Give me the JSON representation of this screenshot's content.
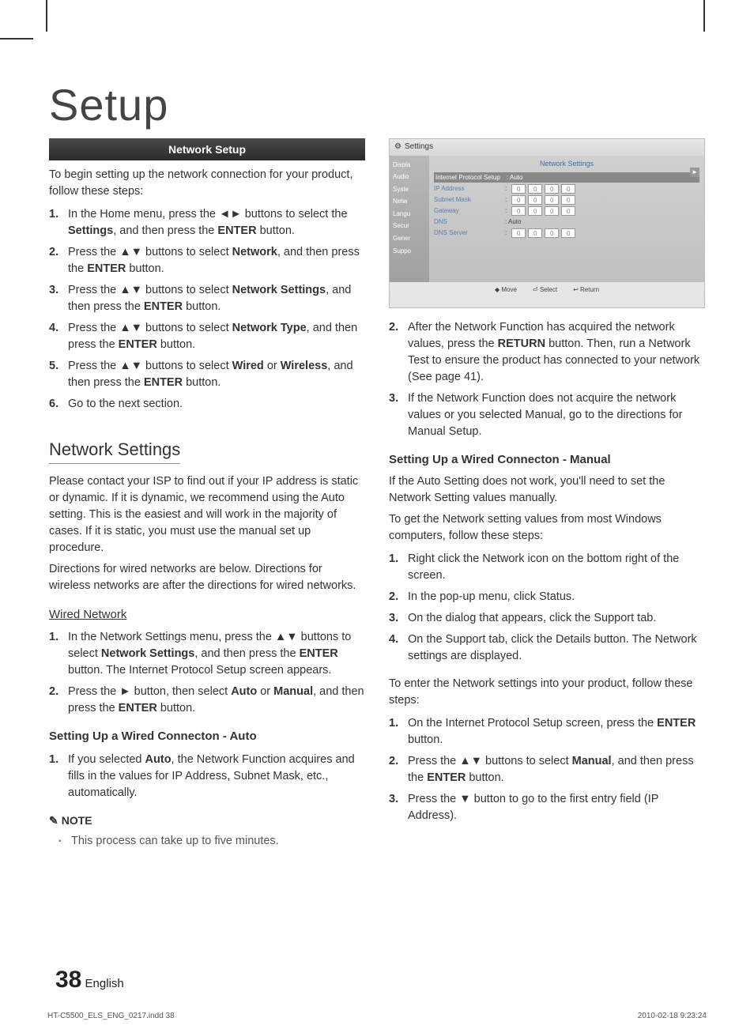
{
  "title": "Setup",
  "left": {
    "barTitle": "Network Setup",
    "intro": "To begin setting up the network connection for your product, follow these steps:",
    "steps": [
      {
        "n": "1.",
        "pre": "In the Home menu, press the ◄► buttons to select the ",
        "b1": "Settings",
        "mid": ", and then press the ",
        "b2": "ENTER",
        "post": " button."
      },
      {
        "n": "2.",
        "pre": "Press the ▲▼ buttons to select ",
        "b1": "Network",
        "mid": ", and then press the ",
        "b2": "ENTER",
        "post": " button."
      },
      {
        "n": "3.",
        "pre": "Press the ▲▼ buttons to select ",
        "b1": "Network Settings",
        "mid": ", and then press the ",
        "b2": "ENTER",
        "post": " button."
      },
      {
        "n": "4.",
        "pre": "Press the ▲▼ buttons to select ",
        "b1": "Network Type",
        "mid": ", and then press the ",
        "b2": "ENTER",
        "post": " button."
      },
      {
        "n": "5.",
        "pre": "Press the ▲▼ buttons to select ",
        "b1": "Wired",
        "mid": " or ",
        "b2": "Wireless",
        "mid2": ", and then press the ",
        "b3": "ENTER",
        "post": " button."
      },
      {
        "n": "6.",
        "pre": "Go to the next section.",
        "b1": "",
        "mid": "",
        "b2": "",
        "post": ""
      }
    ],
    "h2": "Network Settings",
    "nsP1": "Please contact your ISP to find out if your IP address is static or dynamic. If it is dynamic, we recommend using the Auto setting. This is the easiest and will work in the majority of cases. If it is static, you must use the manual set up procedure.",
    "nsP2": "Directions for wired networks are below. Directions for wireless networks are after the directions for wired networks.",
    "wiredH": "Wired Network",
    "wiredSteps": [
      {
        "n": "1.",
        "html": "In the Network Settings menu, press the ▲▼ buttons to select <b>Network Settings</b>, and then press the <b>ENTER</b> button. The Internet Protocol Setup screen appears."
      },
      {
        "n": "2.",
        "html": "Press the ► button, then select <b>Auto</b> or <b>Manual</b>, and then press the <b>ENTER</b> button."
      }
    ],
    "autoH": "Setting Up a Wired Connecton - Auto",
    "autoSteps": [
      {
        "n": "1.",
        "html": "If you selected <b>Auto</b>, the Network Function acquires and fills in the values for IP Address, Subnet Mask, etc., automatically."
      }
    ],
    "noteLabel": "NOTE",
    "noteItem": "This process can take up to five minutes."
  },
  "right": {
    "ss": {
      "headIcon": "⚙",
      "headText": "Settings",
      "title": "Network Settings",
      "nav": [
        "Displa",
        "Audio",
        "Syste",
        "Netw",
        "Langu",
        "Secur",
        "Gener",
        "Suppo"
      ],
      "rowHL": {
        "lbl": "Internet Protocol Setup",
        "val": ": Auto"
      },
      "rows": [
        {
          "lbl": "IP Address",
          "boxes": [
            "0",
            "0",
            "0",
            "0"
          ]
        },
        {
          "lbl": "Subnet Mask",
          "boxes": [
            "0",
            "0",
            "0",
            "0"
          ]
        },
        {
          "lbl": "Gateway",
          "boxes": [
            "0",
            "0",
            "0",
            "0"
          ]
        }
      ],
      "dns": {
        "lbl": "DNS",
        "val": ": Auto"
      },
      "dnsServer": {
        "lbl": "DNS Server",
        "boxes": [
          "0",
          "0",
          "0",
          "0"
        ]
      },
      "foot": [
        "◆ Move",
        "⏎ Select",
        "↩ Return"
      ]
    },
    "contSteps": [
      {
        "n": "2.",
        "html": "After the Network Function has acquired the network values, press the <b>RETURN</b> button. Then, run a Network Test to ensure the product has connected to your network (See page 41)."
      },
      {
        "n": "3.",
        "html": "If the Network Function does not acquire the network values or you selected Manual, go to the directions for Manual Setup."
      }
    ],
    "manualH": "Setting Up a Wired Connecton - Manual",
    "manP1": "If the Auto Setting does not work, you'll need to set the Network Setting values manually.",
    "manP2": "To get the Network setting values from most Windows computers, follow these steps:",
    "manSteps": [
      {
        "n": "1.",
        "html": "Right click the Network icon on the bottom right of the screen."
      },
      {
        "n": "2.",
        "html": "In the pop-up menu, click Status."
      },
      {
        "n": "3.",
        "html": "On the dialog that appears, click the Support tab."
      },
      {
        "n": "4.",
        "html": "On the Support tab, click the Details button. The Network settings are displayed."
      }
    ],
    "enterP": "To enter the Network settings into your product, follow these steps:",
    "enterSteps": [
      {
        "n": "1.",
        "html": "On the Internet Protocol Setup screen, press the <b>ENTER</b> button."
      },
      {
        "n": "2.",
        "html": "Press the ▲▼ buttons to select <b>Manual</b>, and then press the <b>ENTER</b> button."
      },
      {
        "n": "3.",
        "html": "Press the ▼ button to go to the first entry field (IP Address)."
      }
    ]
  },
  "footer": {
    "page": "38",
    "lang": "English"
  },
  "print": {
    "file": "HT-C5500_ELS_ENG_0217.indd   38",
    "ts": "2010-02-18     9:23:24"
  }
}
